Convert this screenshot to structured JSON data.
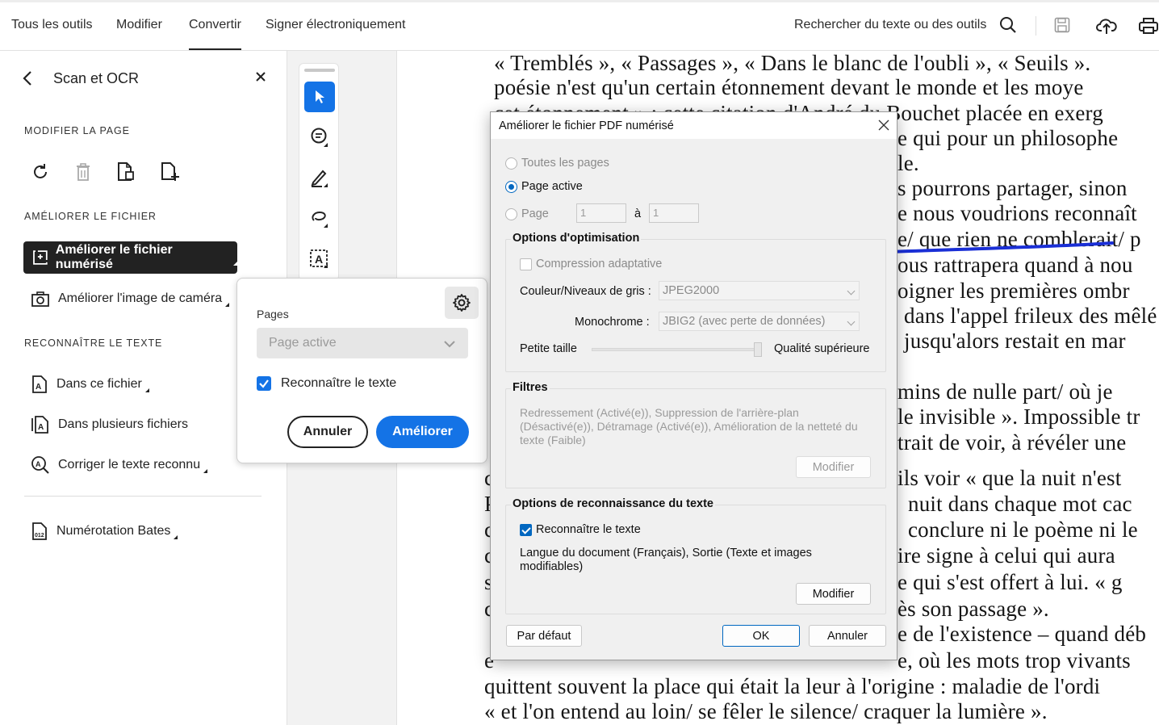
{
  "topnav": {
    "tabs": [
      "Tous les outils",
      "Modifier",
      "Convertir",
      "Signer électroniquement"
    ],
    "search_label": "Rechercher du texte ou des outils"
  },
  "sidebar": {
    "title": "Scan et OCR",
    "sections": {
      "modify_page": "MODIFIER LA PAGE",
      "improve_file": "AMÉLIORER LE FICHIER",
      "recognize_text": "RECONNAÎTRE LE TEXTE"
    },
    "items": {
      "enhance_scanned": "Améliorer le fichier numérisé",
      "enhance_camera": "Améliorer l'image de caméra",
      "in_this_file": "Dans ce fichier",
      "in_multiple_files": "Dans plusieurs fichiers",
      "correct_text": "Corriger le texte reconnu",
      "bates": "Numérotation Bates"
    }
  },
  "popover": {
    "pages_label": "Pages",
    "pages_value": "Page active",
    "recognize_label": "Reconnaître le texte",
    "cancel": "Annuler",
    "enhance": "Améliorer"
  },
  "dialog": {
    "title": "Améliorer le fichier PDF numérisé",
    "all_pages": "Toutes les pages",
    "active_page": "Page active",
    "page": "Page",
    "from_value": "1",
    "to_label": "à",
    "to_value": "1",
    "optim_group": "Options d'optimisation",
    "adaptive": "Compression adaptative",
    "color_label": "Couleur/Niveaux de gris :",
    "color_value": "JPEG2000",
    "mono_label": "Monochrome :",
    "mono_value": "JBIG2 (avec perte de données)",
    "small_size": "Petite taille",
    "high_quality": "Qualité supérieure",
    "slider_level": 1.0,
    "filters_group": "Filtres",
    "filters_text": "Redressement (Activé(e)), Suppression de l'arrière-plan (Désactivé(e)), Détramage (Activé(e)), Amélioration de la netteté du texte (Faible)",
    "modify1": "Modifier",
    "ocr_group": "Options de reconnaissance du texte",
    "ocr_check": "Reconnaître le texte",
    "ocr_desc": "Langue du document (Français), Sortie (Texte et images modifiables)",
    "modify2": "Modifier",
    "default": "Par défaut",
    "ok": "OK",
    "cancel": "Annuler"
  },
  "document": {
    "lines": [
      "« Tremblés », « Passages », « Dans le blanc de l'oubli », « Seuils ».",
      "poésie n'est qu'un certain étonnement devant le monde et les moye",
      "cet étonnement » : cette citation d'André du Bouchet placée en exerg",
      "e qui pour un philosophe",
      "le.",
      "s pourrons partager, sinon",
      "e nous voudrions reconnaît",
      "e/ que rien ne comblerait/ p",
      "ous rattrapera quand à nou",
      "oigner les premières ombr",
      "dans l'appel frileux des mêlé",
      "jusqu'alors restait en mar",
      "mins de nulle part/ où je",
      "le invisible ». Impossible tr",
      "trait de voir, à révéler une",
      "ils voir « que la nuit n'est",
      "nuit dans chaque mot cac",
      "conclure ni le poème ni le",
      "ire signe à celui qui aura",
      "e qui s'est offert à lui. « g",
      "ès son passage ».",
      "e de l'existence – quand déb",
      "e, où les mots trop vivants",
      "quittent souvent la place qui était la leur à l'origine : maladie de l'ordi",
      "« et l'on entend au loin/ se fêler le silence/ craquer la lumière »."
    ]
  },
  "colors": {
    "accent": "#1473e6",
    "win_accent": "#0067c0",
    "annotation": "#1a2fd6"
  }
}
